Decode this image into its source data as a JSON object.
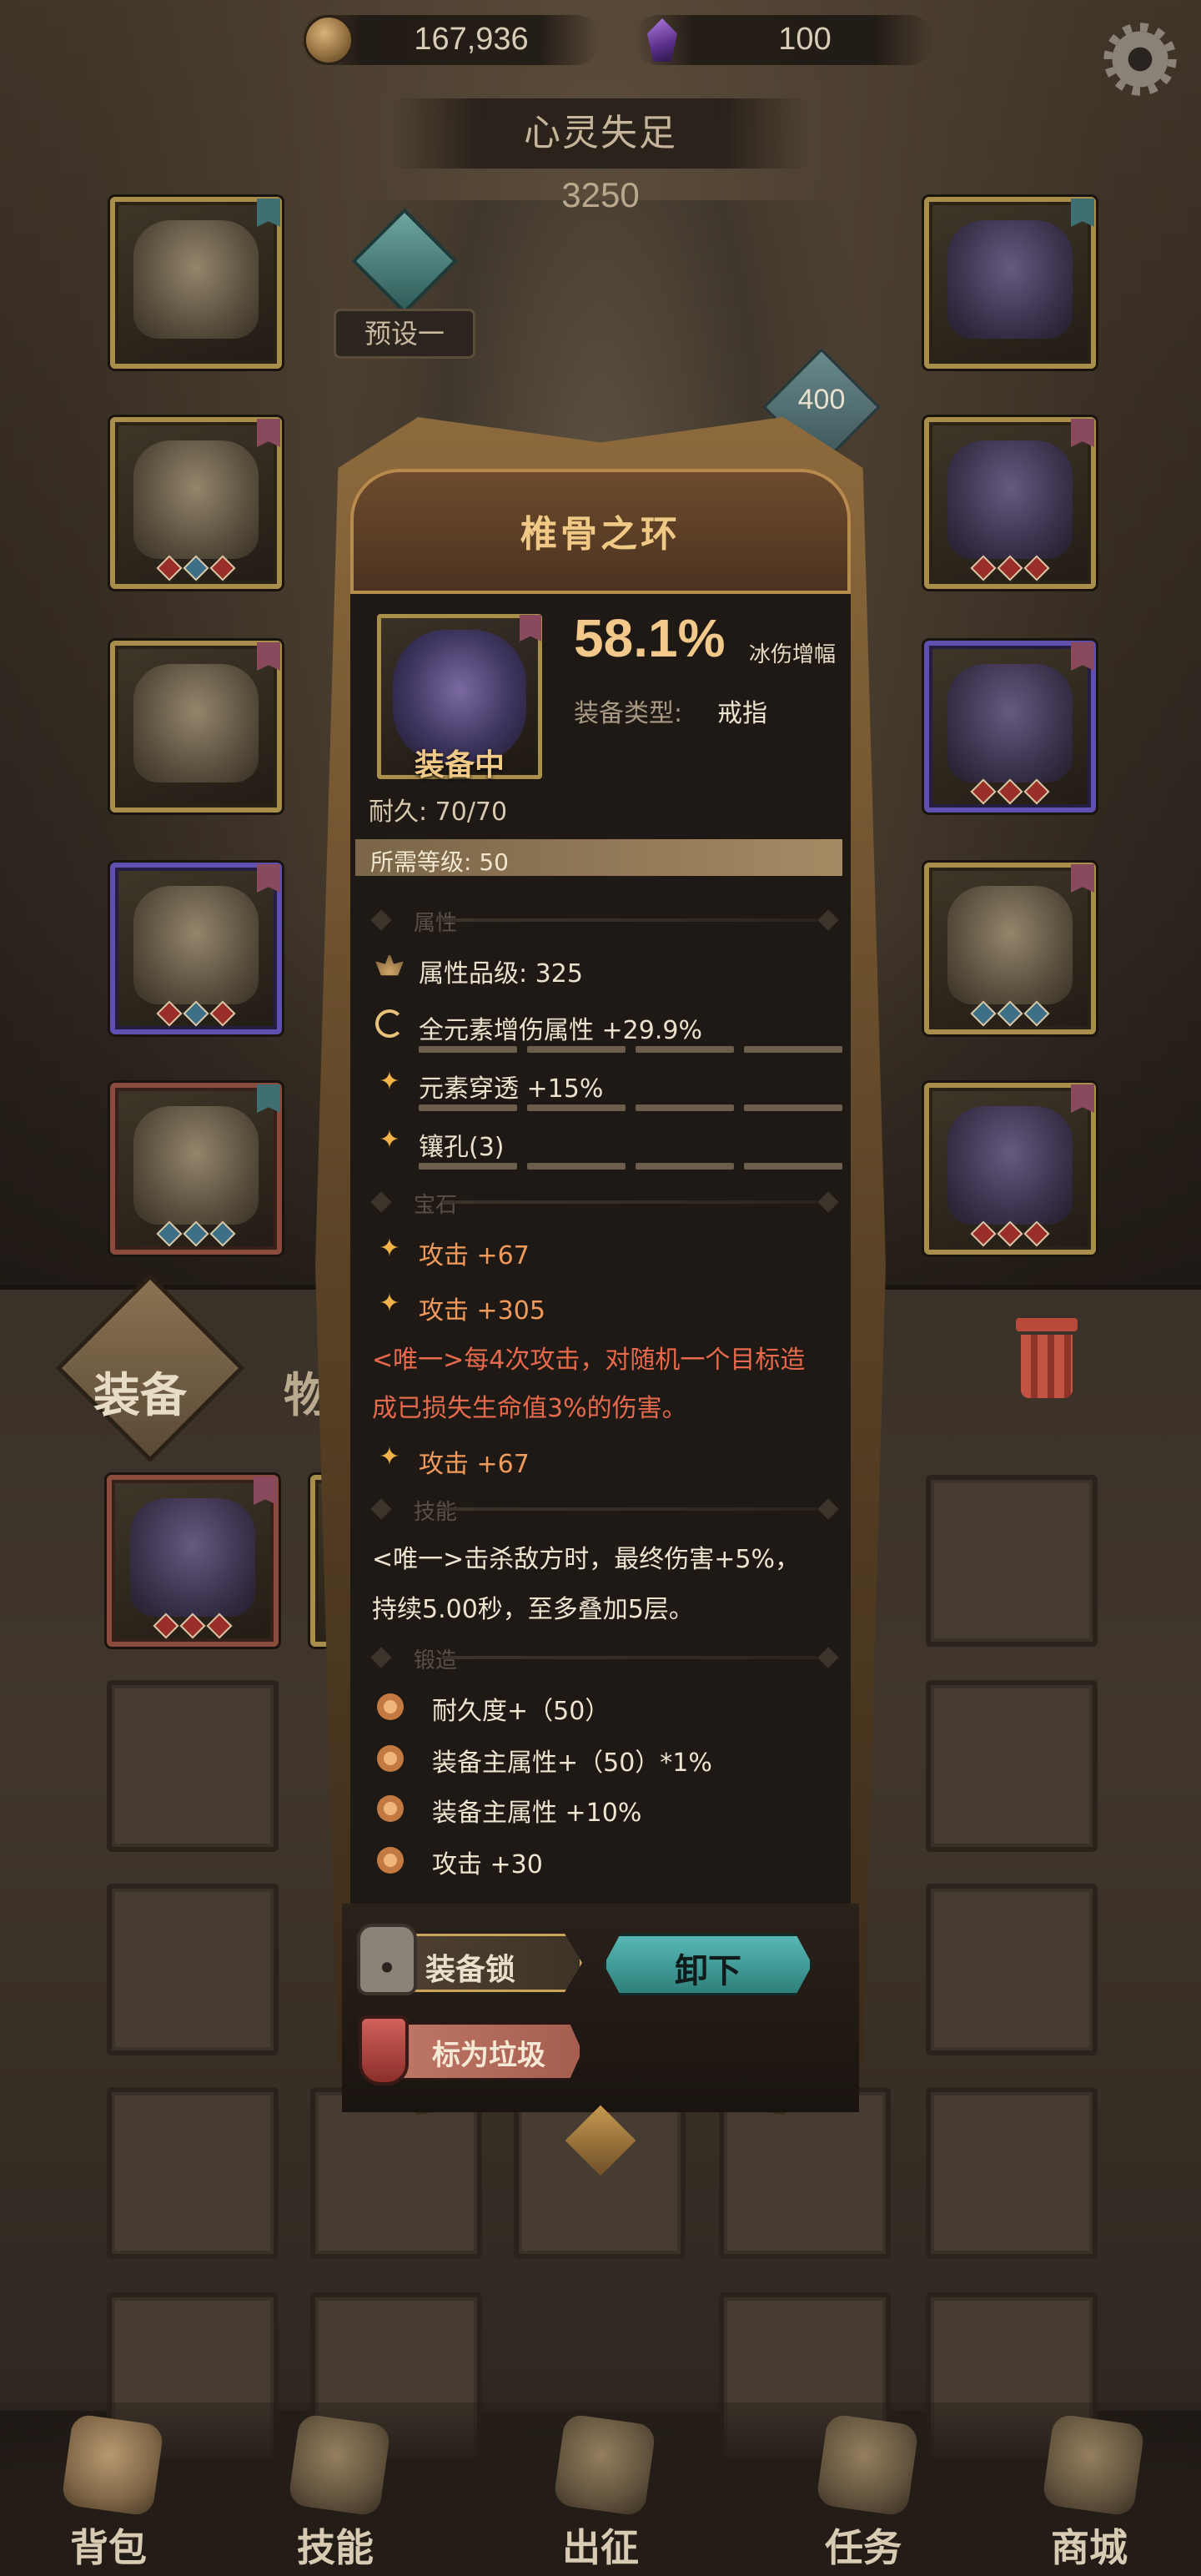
{
  "top_bar": {
    "gold_amount": "167,936",
    "gem_amount": "100",
    "gold_icon": "coin-icon",
    "gem_icon": "crystal-icon",
    "settings_icon": "gear-icon"
  },
  "character": {
    "title": "心灵失足",
    "power": "3250",
    "preset_label": "预设一",
    "weapon_level": "400"
  },
  "slots": {
    "left": [
      {
        "item": "hood",
        "quality": "gold"
      },
      {
        "item": "robe",
        "quality": "gold"
      },
      {
        "item": "gloves",
        "quality": "gold"
      },
      {
        "item": "pants",
        "quality": "purple"
      },
      {
        "item": "boots",
        "quality": "red"
      }
    ],
    "right": [
      {
        "item": "amulet",
        "quality": "gold"
      },
      {
        "item": "vertebra-ring",
        "quality": "gold"
      },
      {
        "item": "chain-bracer",
        "quality": "purple"
      },
      {
        "item": "staff",
        "quality": "gold"
      },
      {
        "item": "tome",
        "quality": "gold"
      }
    ]
  },
  "tabs": {
    "equipment": "装备",
    "items": "物品"
  },
  "inventory": {
    "first_item": "cross-necklace"
  },
  "modal": {
    "title": "椎骨之环",
    "equipped_label": "装备中",
    "durability": "耐久: 70/70",
    "main_stat_value": "58.1%",
    "main_stat_name": "冰伤增幅",
    "equip_type_label": "装备类型:",
    "equip_type_value": "戒指",
    "required_level": "所需等级: 50",
    "sections": {
      "attributes": "属性",
      "gems": "宝石",
      "skills": "技能",
      "forge": "锻造"
    },
    "attributes": [
      {
        "icon": "lotus-icon",
        "text": "属性品级: 325"
      },
      {
        "icon": "cycle-icon",
        "text": "全元素增伤属性 +29.9%"
      },
      {
        "icon": "spark-icon",
        "text": "元素穿透 +15%"
      },
      {
        "icon": "spark-icon",
        "text": "镶孔(3)"
      }
    ],
    "gems": [
      {
        "text": "攻击 +67"
      },
      {
        "text": "攻击 +305"
      }
    ],
    "unique_effect": {
      "line1": "<唯一>每4次攻击，对随机一个目标造",
      "line2": "成已损失生命值3%的伤害。"
    },
    "gem_after": "攻击 +67",
    "skill": {
      "line1": "<唯一>击杀敌方时，最终伤害+5%，",
      "line2": "持续5.00秒，至多叠加5层。"
    },
    "forge": [
      "耐久度+（50）",
      "装备主属性+（50）*1%",
      "装备主属性 +10%",
      "攻击 +30"
    ],
    "lock_button": "装备锁",
    "unequip_button": "卸下",
    "trash_button": "标为垃圾"
  },
  "bottom_nav": [
    {
      "label": "背包",
      "icon": "backpack-icon"
    },
    {
      "label": "技能",
      "icon": "skill-book-icon"
    },
    {
      "label": "出征",
      "icon": "battle-icon"
    },
    {
      "label": "任务",
      "icon": "horn-icon"
    },
    {
      "label": "商城",
      "icon": "shop-icon"
    }
  ]
}
